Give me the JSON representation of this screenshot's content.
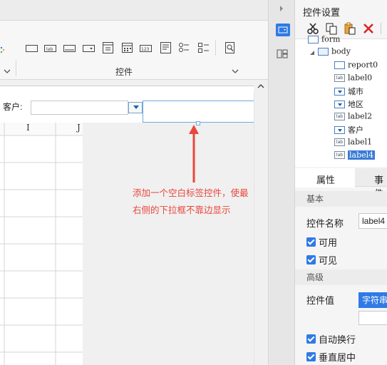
{
  "toolbar": {
    "group_label": "控件",
    "icons": [
      "label-icon",
      "textbox-icon",
      "button-icon",
      "combobox-icon",
      "list-icon",
      "calendar-icon",
      "number-icon",
      "textarea-icon",
      "radiogroup-icon",
      "checkboxgroup-icon",
      "search-icon"
    ]
  },
  "form": {
    "customer_label": "客户:"
  },
  "grid": {
    "columns": [
      "I",
      "J"
    ]
  },
  "annotation": {
    "text": "添加一个空白标签控件，使最右侧的下拉框不靠边显示",
    "color": "#e8473c"
  },
  "panel": {
    "title": "控件设置",
    "tree": {
      "partial_top": "form",
      "body": "body",
      "items": [
        {
          "name": "report0",
          "type": "report"
        },
        {
          "name": "label0",
          "type": "label"
        },
        {
          "name": "城市",
          "type": "combo"
        },
        {
          "name": "地区",
          "type": "combo"
        },
        {
          "name": "label2",
          "type": "label"
        },
        {
          "name": "客户",
          "type": "combo"
        },
        {
          "name": "label1",
          "type": "label"
        },
        {
          "name": "label4",
          "type": "label",
          "selected": true
        }
      ]
    },
    "tabs": [
      "属性",
      "事件"
    ],
    "sections": {
      "basic": "基本",
      "advanced": "高级"
    },
    "props": {
      "name_label": "控件名称",
      "name_value": "label4",
      "enabled": "可用",
      "visible": "可见",
      "value_label": "控件值",
      "value_type": "字符串",
      "autowrap": "自动换行",
      "vcenter": "垂直居中"
    }
  },
  "colors": {
    "accent": "#2f7ae5",
    "selection": "#3a7bd5",
    "annotation": "#e8473c"
  }
}
